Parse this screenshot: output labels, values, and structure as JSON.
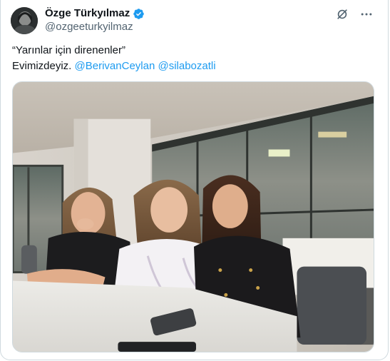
{
  "author": {
    "display_name": "Özge Türkyılmaz",
    "handle": "@ozgeeturkyilmaz",
    "verified": true
  },
  "icons": {
    "verified": "verified-badge-icon",
    "grok": "grok-icon",
    "more": "more-options-icon"
  },
  "tweet": {
    "line1": "“Yarınlar için direnenler”",
    "line2_text": "Evimizdeyiz. ",
    "mentions": [
      "@BerivanCeylan",
      "@silabozatli"
    ]
  },
  "colors": {
    "accent": "#1d9bf0",
    "secondary_text": "#536471",
    "border": "#cfd9de"
  }
}
